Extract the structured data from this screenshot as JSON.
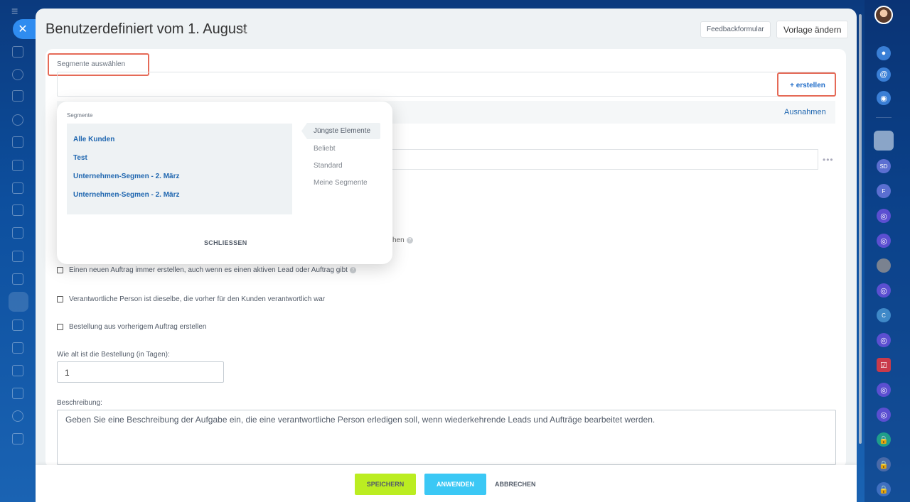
{
  "header": {
    "title": "Benutzerdefiniert vom 1. August",
    "feedback_label": "Feedbackformular",
    "template_label": "Vorlage ändern"
  },
  "segments": {
    "label": "Segmente auswählen",
    "create_label": "+ erstellen",
    "exceptions_label": "Ausnahmen"
  },
  "popup": {
    "title": "Segmente",
    "items": [
      "Alle Kunden",
      "Test",
      "Unternehmen-Segmen - 2. März",
      "Unternehmen-Segmen - 2. März"
    ],
    "tabs": [
      "Jüngste Elemente",
      "Beliebt",
      "Standard",
      "Meine Segmente"
    ],
    "active_tab": "Jüngste Elemente",
    "close_label": "SCHLIESSEN"
  },
  "form": {
    "hidden_option_tail": "hen",
    "options": [
      "Einen neuen Auftrag immer erstellen, auch wenn es einen aktiven Lead oder Auftrag gibt",
      "Verantwortliche Person ist dieselbe, die vorher für den Kunden verantwortlich war",
      "Bestellung aus vorherigem Auftrag erstellen"
    ],
    "days_label": "Wie alt ist die Bestellung (in Tagen):",
    "days_value": "1",
    "description_label": "Beschreibung:",
    "description_value": "Geben Sie eine Beschreibung der Aufgabe ein, die eine verantwortliche Person erledigen soll, wenn wiederkehrende Leads und Aufträge bearbeitet werden."
  },
  "footer": {
    "save_label": "SPEICHERN",
    "apply_label": "ANWENDEN",
    "cancel_label": "ABBRECHEN"
  },
  "colors": {
    "accent_blue": "#2067b0",
    "save_green": "#bbed21",
    "apply_cyan": "#3bc8f5",
    "highlight_red": "#e56a57"
  },
  "icons": {
    "left_rail": [
      "menu-icon",
      "close-icon",
      "home-icon",
      "feed-icon",
      "tasks-icon",
      "contacts-icon",
      "documents-icon",
      "payments-icon",
      "chat-icon",
      "checklist-icon",
      "messages-icon",
      "analytics-icon",
      "cart-icon",
      "crm-icon",
      "store-icon",
      "filter-icon",
      "screen-icon",
      "group-icon",
      "settings-icon",
      "table-icon"
    ],
    "right_rail": [
      "user-avatar",
      "bell-icon",
      "at-icon",
      "chat-icon",
      "user-avatar",
      "contact-sd",
      "contact-f",
      "channel-icon",
      "channel-icon",
      "user-avatar",
      "channel-icon",
      "contact-c",
      "channel-icon",
      "task-icon",
      "channel-icon",
      "channel-icon",
      "lock-icon",
      "lock-icon",
      "lock-icon"
    ],
    "right_rail_letters": [
      "SD",
      "F",
      "C"
    ]
  }
}
